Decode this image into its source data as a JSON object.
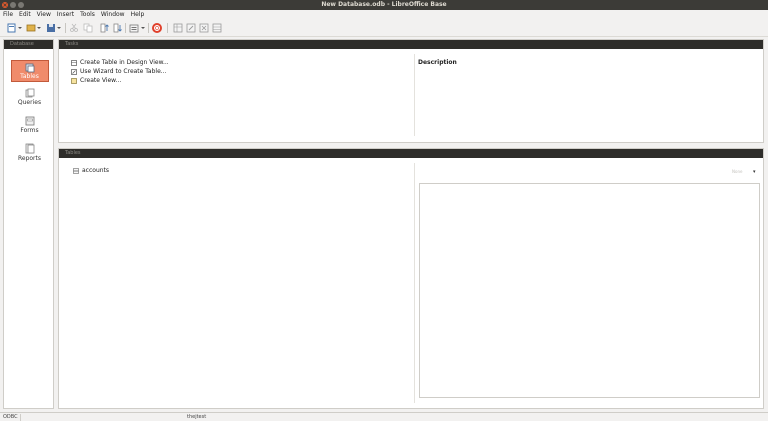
{
  "window": {
    "title": "New Database.odb - LibreOffice Base"
  },
  "menu": [
    "File",
    "Edit",
    "View",
    "Insert",
    "Tools",
    "Window",
    "Help"
  ],
  "toolbar": {
    "icons": [
      "new-document-icon",
      "open-icon",
      "save-icon",
      "cut-icon",
      "copy-icon",
      "paste-icon",
      "sort-ascending-icon",
      "sort-descending-icon",
      "form-icon",
      "help-icon",
      "table-view-icon",
      "edit-icon",
      "delete-icon",
      "rename-icon"
    ]
  },
  "sidebar": {
    "header": "Database",
    "items": [
      {
        "label": "Tables",
        "active": true
      },
      {
        "label": "Queries",
        "active": false
      },
      {
        "label": "Forms",
        "active": false
      },
      {
        "label": "Reports",
        "active": false
      }
    ]
  },
  "tasks": {
    "header": "Tasks",
    "items": [
      {
        "label": "Create Table in Design View..."
      },
      {
        "label": "Use Wizard to Create Table..."
      },
      {
        "label": "Create View..."
      }
    ],
    "description_label": "Description"
  },
  "tables": {
    "header": "Tables",
    "items": [
      {
        "label": "accounts"
      }
    ],
    "preview_option": "None"
  },
  "status": {
    "left": "ODBC",
    "middle": "thejtest"
  },
  "colors": {
    "titlebar": "#3c3b37",
    "accent": "#f08b6b",
    "panel_header": "#2e2d2a"
  }
}
